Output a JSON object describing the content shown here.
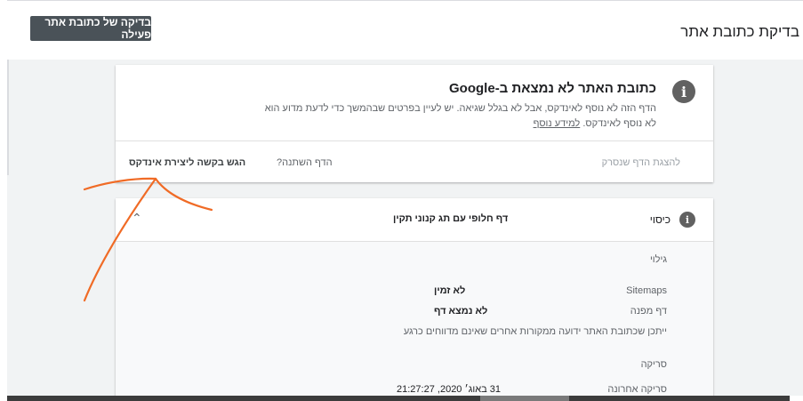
{
  "header": {
    "title": "בדיקת כתובת אתר",
    "test_live_label": "בדיקה של כתובת אתר פעילה"
  },
  "status_card": {
    "info_icon": "info-icon",
    "heading": "כתובת האתר לא נמצאת ב-Google",
    "description": "הדף הזה לא נוסף לאינדקס, אבל לא בגלל שגיאה. יש לעיין בפרטים שבהמשך כדי לדעת מדוע הוא לא נוסף לאינדקס.",
    "learn_more": "למידע נוסף",
    "view_crawled": "להצגת הדף שנסרק",
    "page_changed": "הדף השתנה?",
    "request_indexing": "הגש בקשה ליצירת אינדקס"
  },
  "coverage_card": {
    "title": "כיסוי",
    "status": "דף חלופי עם תג קנוני תקין",
    "discovery_section": "גילוי",
    "rows": [
      {
        "label": "Sitemaps",
        "value": "לא זמין"
      },
      {
        "label": "דף מפנה",
        "value": "לא נמצא דף"
      }
    ],
    "discovery_note": "ייתכן שכתובת האתר ידועה ממקורות אחרים שאינם מדווחים כרגע",
    "crawl_section": "סריקה",
    "last_crawl_label": "סריקה אחרונה",
    "last_crawl_value": "31 באוג׳ 2020, 21:27:27"
  },
  "colors": {
    "annotation": "#f06b26",
    "button_bg": "#4a5258",
    "info_icon_bg": "#616161"
  }
}
